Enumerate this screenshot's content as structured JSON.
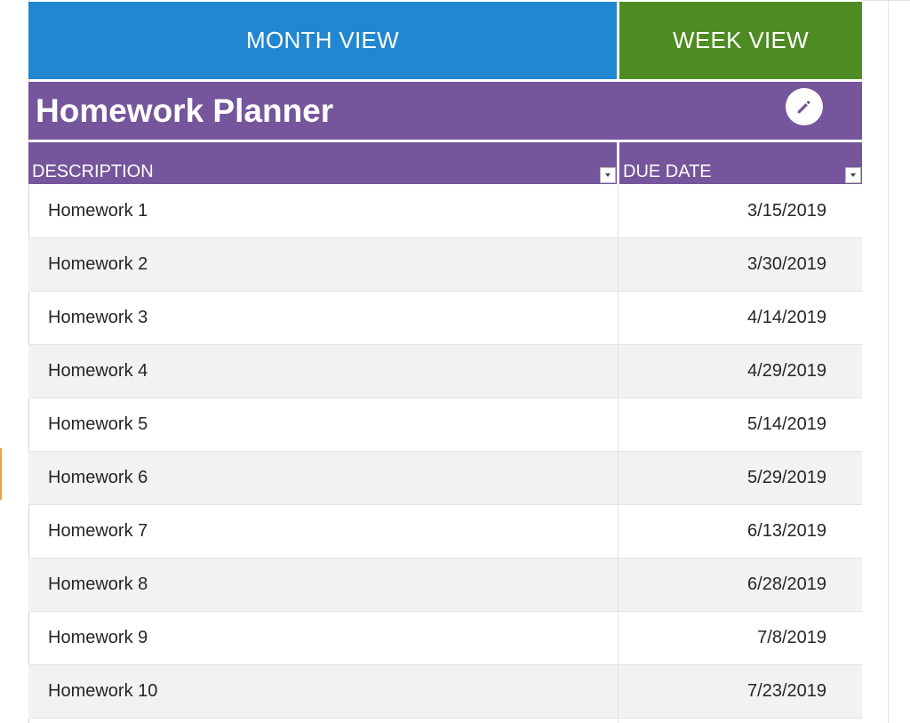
{
  "nav": {
    "month_view": "MONTH VIEW",
    "week_view": "WEEK VIEW"
  },
  "title": "Homework Planner",
  "edit_icon": "pencil-icon",
  "table": {
    "columns": [
      "DESCRIPTION",
      "DUE DATE"
    ],
    "rows": [
      {
        "description": "Homework 1",
        "due": "3/15/2019"
      },
      {
        "description": "Homework 2",
        "due": "3/30/2019"
      },
      {
        "description": "Homework 3",
        "due": "4/14/2019"
      },
      {
        "description": "Homework 4",
        "due": "4/29/2019"
      },
      {
        "description": "Homework 5",
        "due": "5/14/2019"
      },
      {
        "description": "Homework 6",
        "due": "5/29/2019"
      },
      {
        "description": "Homework 7",
        "due": "6/13/2019"
      },
      {
        "description": "Homework 8",
        "due": "6/28/2019"
      },
      {
        "description": "Homework 9",
        "due": "7/8/2019"
      },
      {
        "description": "Homework 10",
        "due": "7/23/2019"
      }
    ]
  },
  "colors": {
    "month_view": "#2187d0",
    "week_view": "#4e8b22",
    "header_purple": "#75559b",
    "row_alt": "#f2f2f2"
  }
}
